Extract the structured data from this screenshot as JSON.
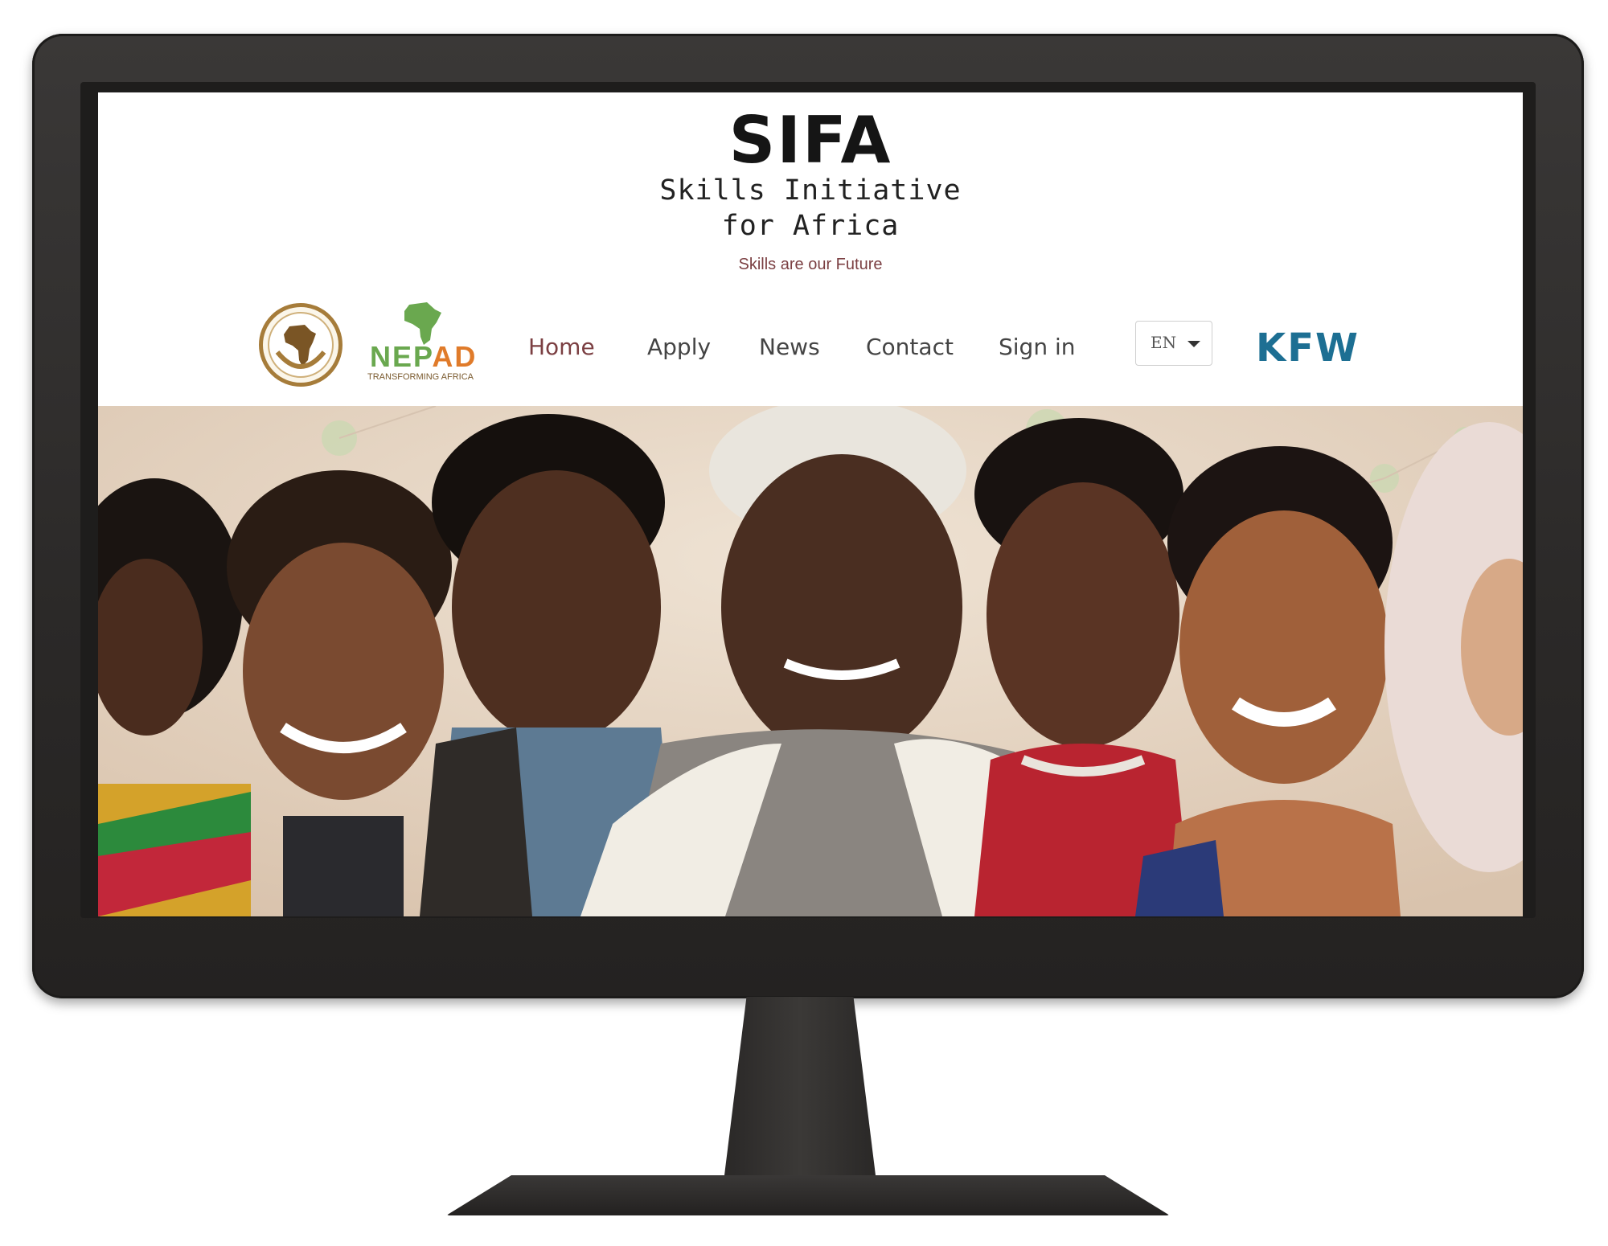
{
  "header": {
    "logo_text": "SIFA",
    "name_line1": "Skills Initiative",
    "name_line2": "for Africa",
    "tagline": "Skills are our Future"
  },
  "partners": {
    "nepad_word_green": "NEP",
    "nepad_word_orange": "AD",
    "nepad_sub": "TRANSFORMING AFRICA",
    "kfw": "KFW"
  },
  "nav": {
    "items": [
      {
        "label": "Home",
        "active": true
      },
      {
        "label": "Apply"
      },
      {
        "label": "News"
      },
      {
        "label": "Contact"
      },
      {
        "label": "Sign in"
      }
    ]
  },
  "language": {
    "selected": "EN"
  },
  "colors": {
    "accent": "#7b3f42",
    "kfw_blue": "#1d6f93",
    "nepad_green": "#6aa84f",
    "nepad_orange": "#e07b2a"
  }
}
